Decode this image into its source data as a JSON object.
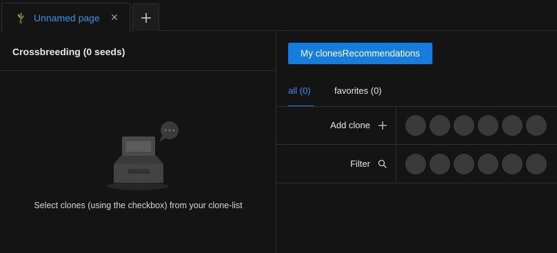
{
  "tabbar": {
    "tabs": [
      {
        "label": "Unnamed page",
        "icon": "plant-icon",
        "active": true
      }
    ],
    "close_icon": "close-icon",
    "add_icon": "plus-icon"
  },
  "left_panel": {
    "title": "Crossbreeding (0 seeds)",
    "empty_icon": "empty-inbox-icon",
    "empty_text": "Select clones (using the checkbox) from your clone-list"
  },
  "right_panel": {
    "primary_button_label": "My clonesRecommendations",
    "subtabs": [
      {
        "label": "all (0)",
        "active": true
      },
      {
        "label": "favorites (0)",
        "active": false
      }
    ],
    "rows": [
      {
        "label": "Add clone",
        "icon": "plus-icon",
        "slots": 6
      },
      {
        "label": "Filter",
        "icon": "search-icon",
        "slots": 6
      }
    ]
  },
  "colors": {
    "background": "#141414",
    "accent": "#177ddc",
    "accent_text": "#3a8fe6",
    "slot": "#3a3a3a",
    "border": "#303030"
  }
}
